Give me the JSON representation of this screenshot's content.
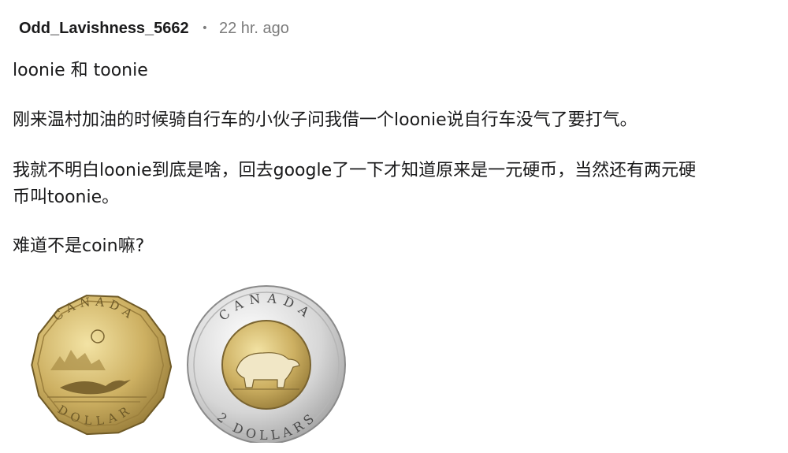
{
  "comment": {
    "author": "Odd_Lavishness_5662",
    "separator": "•",
    "time": "22 hr. ago",
    "paragraphs": [
      "loonie 和 toonie",
      "刚来温村加油的时候骑自行车的小伙子问我借一个loonie说自行车没气了要打气。",
      "我就不明白loonie到底是啥，回去google了一下才知道原来是一元硬币，当然还有两元硬",
      "币叫toonie。",
      "难道不是coin嘛?"
    ]
  },
  "coins": {
    "loonie": {
      "country": "CANADA",
      "denomination": "DOLLAR"
    },
    "toonie": {
      "country": "CANADA",
      "denomination": "2 DOLLARS"
    }
  }
}
